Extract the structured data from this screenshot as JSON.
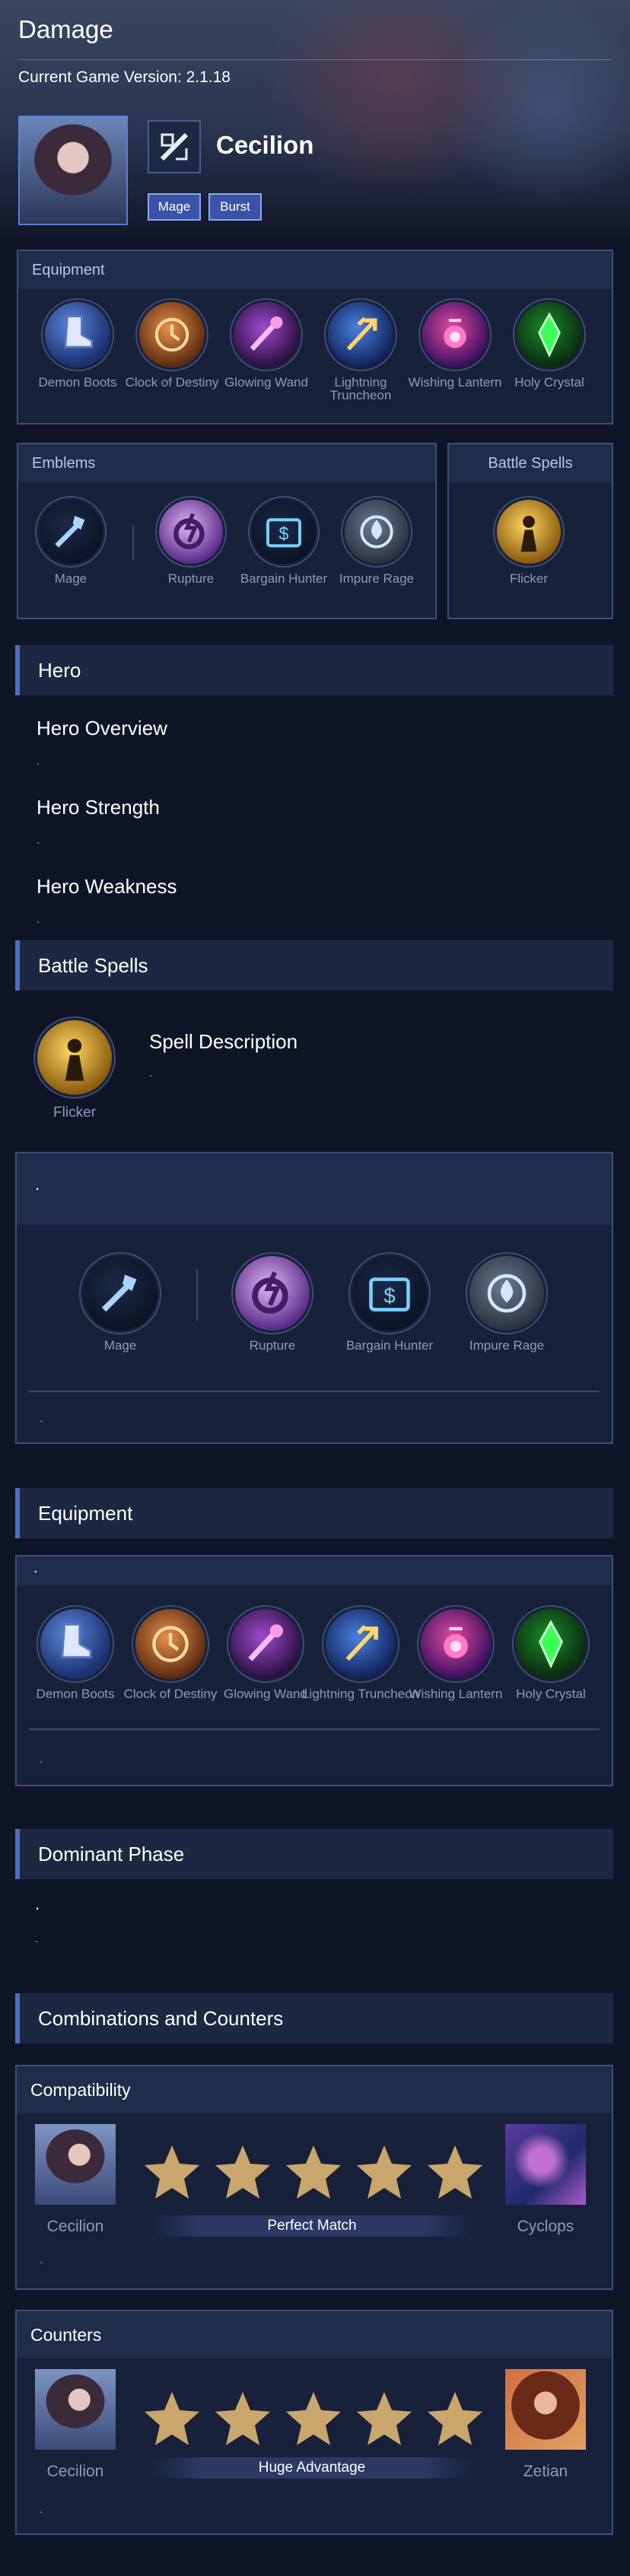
{
  "header": {
    "title": "Damage",
    "version_label": "Current Game Version: 2.1.18",
    "hero_name": "Cecilion",
    "tags": [
      "Mage",
      "Burst"
    ]
  },
  "equipment_panel": {
    "title": "Equipment",
    "items": [
      "Demon Boots",
      "Clock of Destiny",
      "Glowing Wand",
      "Lightning Truncheon",
      "Wishing Lantern",
      "Holy Crystal"
    ]
  },
  "emblems_panel": {
    "title": "Emblems",
    "items": [
      "Mage",
      "Rupture",
      "Bargain Hunter",
      "Impure Rage"
    ]
  },
  "spells_panel": {
    "title": "Battle Spells",
    "items": [
      "Flicker"
    ]
  },
  "hero_section": {
    "title": "Hero",
    "overview": "Hero Overview",
    "strength": "Hero Strength",
    "weakness": "Hero Weakness",
    "placeholder": "."
  },
  "battle_spells_section": {
    "title": "Battle Spells",
    "spell_name": "Flicker",
    "description_title": "Spell Description",
    "description": "."
  },
  "emblem_detail": {
    "title": ".",
    "items": [
      "Mage",
      "Rupture",
      "Bargain Hunter",
      "Impure Rage"
    ],
    "note": "."
  },
  "equipment_section": {
    "title": "Equipment",
    "subtitle": ".",
    "items": [
      "Demon Boots",
      "Clock of Destiny",
      "Glowing Wand",
      "Lightning Truncheon",
      "Wishing Lantern",
      "Holy Crystal"
    ],
    "note": "."
  },
  "dominant_phase": {
    "title": "Dominant Phase",
    "line1": ".",
    "line2": "."
  },
  "combos": {
    "title": "Combinations and Counters",
    "compatibility": {
      "title": "Compatibility",
      "left": "Cecilion",
      "right": "Cyclops",
      "rating": 5,
      "label": "Perfect Match",
      "note": "."
    },
    "counters": {
      "title": "Counters",
      "left": "Cecilion",
      "right": "Zetian",
      "rating": 5,
      "label": "Huge Advantage",
      "note": "."
    }
  },
  "icons": {
    "demon_boots": "boot-icon",
    "clock": "clock-icon",
    "wand": "wand-icon",
    "truncheon": "trident-icon",
    "lantern": "lantern-icon",
    "crystal": "crystal-icon",
    "mage_emblem": "wand-emblem-icon",
    "rupture": "rupture-icon",
    "bargain": "ticket-icon",
    "impure_rage": "flame-icon",
    "flicker": "flicker-icon"
  },
  "colors": {
    "accent": "#4e6fc4",
    "background": "#0f1526",
    "panel": "#17213a",
    "star": "#c9a66b"
  }
}
